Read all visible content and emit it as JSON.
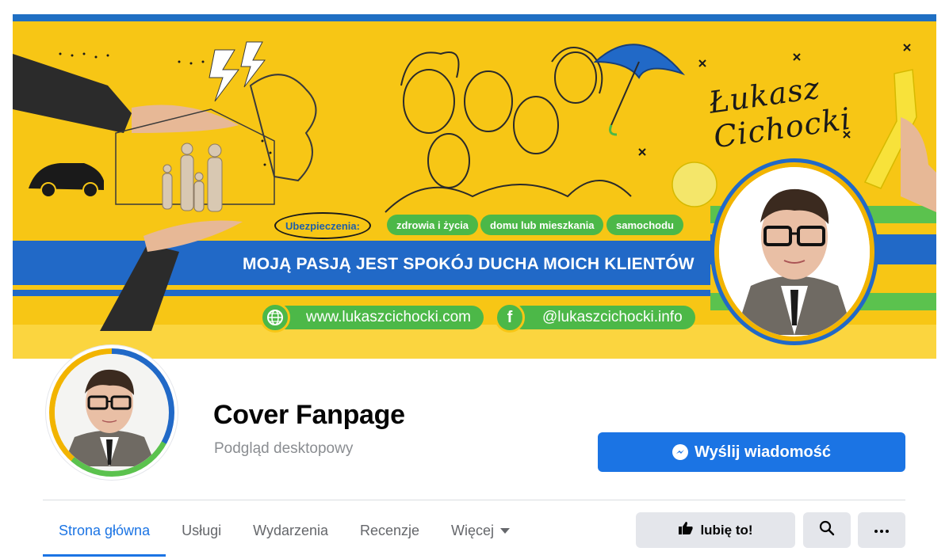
{
  "cover": {
    "insurance_label": "Ubezpieczenia:",
    "pills": [
      "zdrowia i życia",
      "domu lub mieszkania",
      "samochodu"
    ],
    "slogan": "MOJĄ PASJĄ JEST SPOKÓJ DUCHA MOICH KLIENTÓW",
    "website": "www.lukaszcichocki.com",
    "facebook_handle": "@lukaszcichocki.info",
    "facebook_glyph": "f",
    "signature": "Łukasz Cichocki"
  },
  "profile": {
    "name": "Cover Fanpage",
    "subtitle": "Podgląd desktopowy"
  },
  "actions": {
    "message_label": "Wyślij wiadomość",
    "like_label": "lubię to!"
  },
  "tabs": [
    {
      "label": "Strona główna",
      "active": true
    },
    {
      "label": "Usługi",
      "active": false
    },
    {
      "label": "Wydarzenia",
      "active": false
    },
    {
      "label": "Recenzje",
      "active": false
    },
    {
      "label": "Więcej",
      "active": false
    }
  ],
  "icons": {
    "messenger": "messenger-icon",
    "like": "thumbs-up-icon",
    "search": "search-icon",
    "more": "more-icon",
    "globe": "globe-icon",
    "facebook": "facebook-icon"
  },
  "colors": {
    "brand_blue": "#1b74e4",
    "cover_yellow": "#f7c615",
    "cover_blue": "#2169c7",
    "cover_green": "#4cb848",
    "button_gray": "#e4e6eb"
  }
}
